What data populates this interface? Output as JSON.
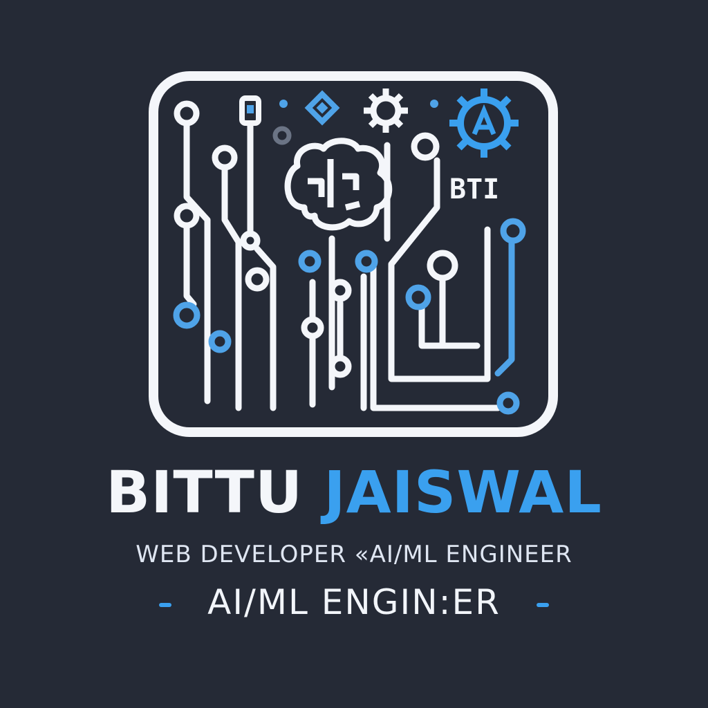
{
  "logo": {
    "badge_text": "BTI",
    "colors": {
      "background": "#252a36",
      "trace_white": "#f4f6fa",
      "trace_blue": "#4fa3e8",
      "accent_blue": "#3aa0ef"
    }
  },
  "brand": {
    "first_name": "BITTU",
    "last_name": "JAISWAL",
    "tagline": "WEB DEVELOPER «AI/ML ENGINEER",
    "sub_tagline": "AI/ML ENGIN:ER"
  }
}
